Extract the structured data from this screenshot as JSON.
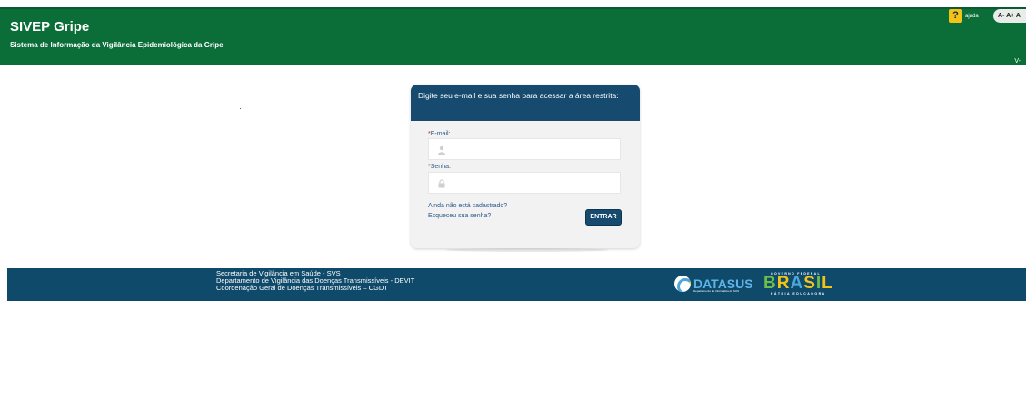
{
  "header": {
    "title": "SIVEP Gripe",
    "subtitle": "Sistema de Informação da Vigilância Epidemiológica da Gripe",
    "help_icon": "?",
    "help_label": "ajuda",
    "font_controls": "A- A+ A",
    "version": "V-"
  },
  "login": {
    "heading": "Digite seu e-mail e sua senha para acessar a área restrita:",
    "email_required_mark": "*",
    "email_label": "E-mail:",
    "email_value": "",
    "email_icon": "user-icon",
    "password_required_mark": "*",
    "password_label": "Senha:",
    "password_value": "",
    "password_icon": "lock-icon",
    "register_link": "Ainda não está cadastrado?",
    "forgot_link": "Esqueceu sua senha?",
    "submit_label": "ENTRAR"
  },
  "footer": {
    "lines": [
      "Secretaria de Vigilância em Saúde - SVS",
      "Departamento de Vigilância das Doenças Transmissíveis - DEVIT",
      "Coordenação Geral de Doenças Transmissíveis – CGDT"
    ],
    "datasus": {
      "name": "DATASUS",
      "subtitle": "Departamento de Informática do SUS"
    },
    "gov": {
      "top": "GOVERNO FEDERAL",
      "word": "BRASIL",
      "bottom": "PÁTRIA EDUCADORA"
    }
  },
  "colors": {
    "header_green": "#0b6e38",
    "card_blue": "#164a6e",
    "footer_blue": "#0f4a6b",
    "link_blue": "#2b5a8a",
    "required_red": "#cc1b1b",
    "help_yellow": "#f3c317"
  }
}
